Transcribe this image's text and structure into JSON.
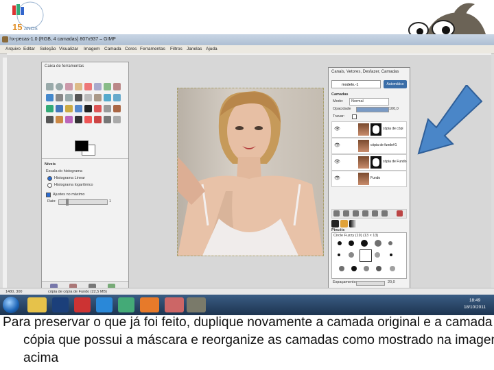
{
  "window": {
    "title": "hx-pecas-1.0 (RGB, 4 camadas) 807x937 – GIMP"
  },
  "menu": [
    "Arquivo",
    "Editar",
    "Seleção",
    "Visualizar",
    "Imagem",
    "Camada",
    "Cores",
    "Ferramentas",
    "Filtros",
    "Janelas",
    "Ajuda"
  ],
  "toolbox": {
    "title": "Caixa de ferramentas",
    "section": "Níveis",
    "scale_label": "Escala do histograma",
    "radio_linear": "Histograma Linear",
    "radio_log": "Histograma logarítmico",
    "checkbox_auto": "Ajustes no máximo",
    "raio_label": "Raio:",
    "raio_value": "1"
  },
  "layers_panel": {
    "title": "Canais, Vetores, Desfazer, Camadas",
    "image_selector": "modelo.-1",
    "auto_button": "Automático",
    "section": "Camadas",
    "mode_label": "Modo:",
    "mode_value": "Normal",
    "opacity_label": "Opacidade",
    "opacity_value": "100,0",
    "lock_label": "Travar:",
    "layers": [
      {
        "name": "cópia de cópi",
        "has_mask": true,
        "selected": false
      },
      {
        "name": "cópia de fundo#1",
        "has_mask": false,
        "selected": false
      },
      {
        "name": "cópia de Fundo",
        "has_mask": true,
        "selected": false
      },
      {
        "name": "Fundo",
        "has_mask": false,
        "selected": false
      }
    ],
    "brushes_section": "Pincéis",
    "brush_name": "Circle Fuzzy (19) (13 × 13)",
    "spacing_label": "Espaçamento:",
    "spacing_value": "20,0"
  },
  "status": {
    "coords": "1480, 300",
    "layer_info": "cópia de cópia de Fundo (22,5 MB)"
  },
  "taskbar": {
    "time": "18:49",
    "date": "18/10/2011"
  },
  "logo": {
    "text": "15 ANOS"
  },
  "caption": "Para preservar o que já foi feito, duplique novamente a camada original e a camada de cópia que possui a máscara e reorganize as camadas como mostrado na imagem acima",
  "colors": {
    "arrow": "#4a86c8",
    "taskbar": "#1d3450",
    "titlebar": "#b9c8da"
  }
}
